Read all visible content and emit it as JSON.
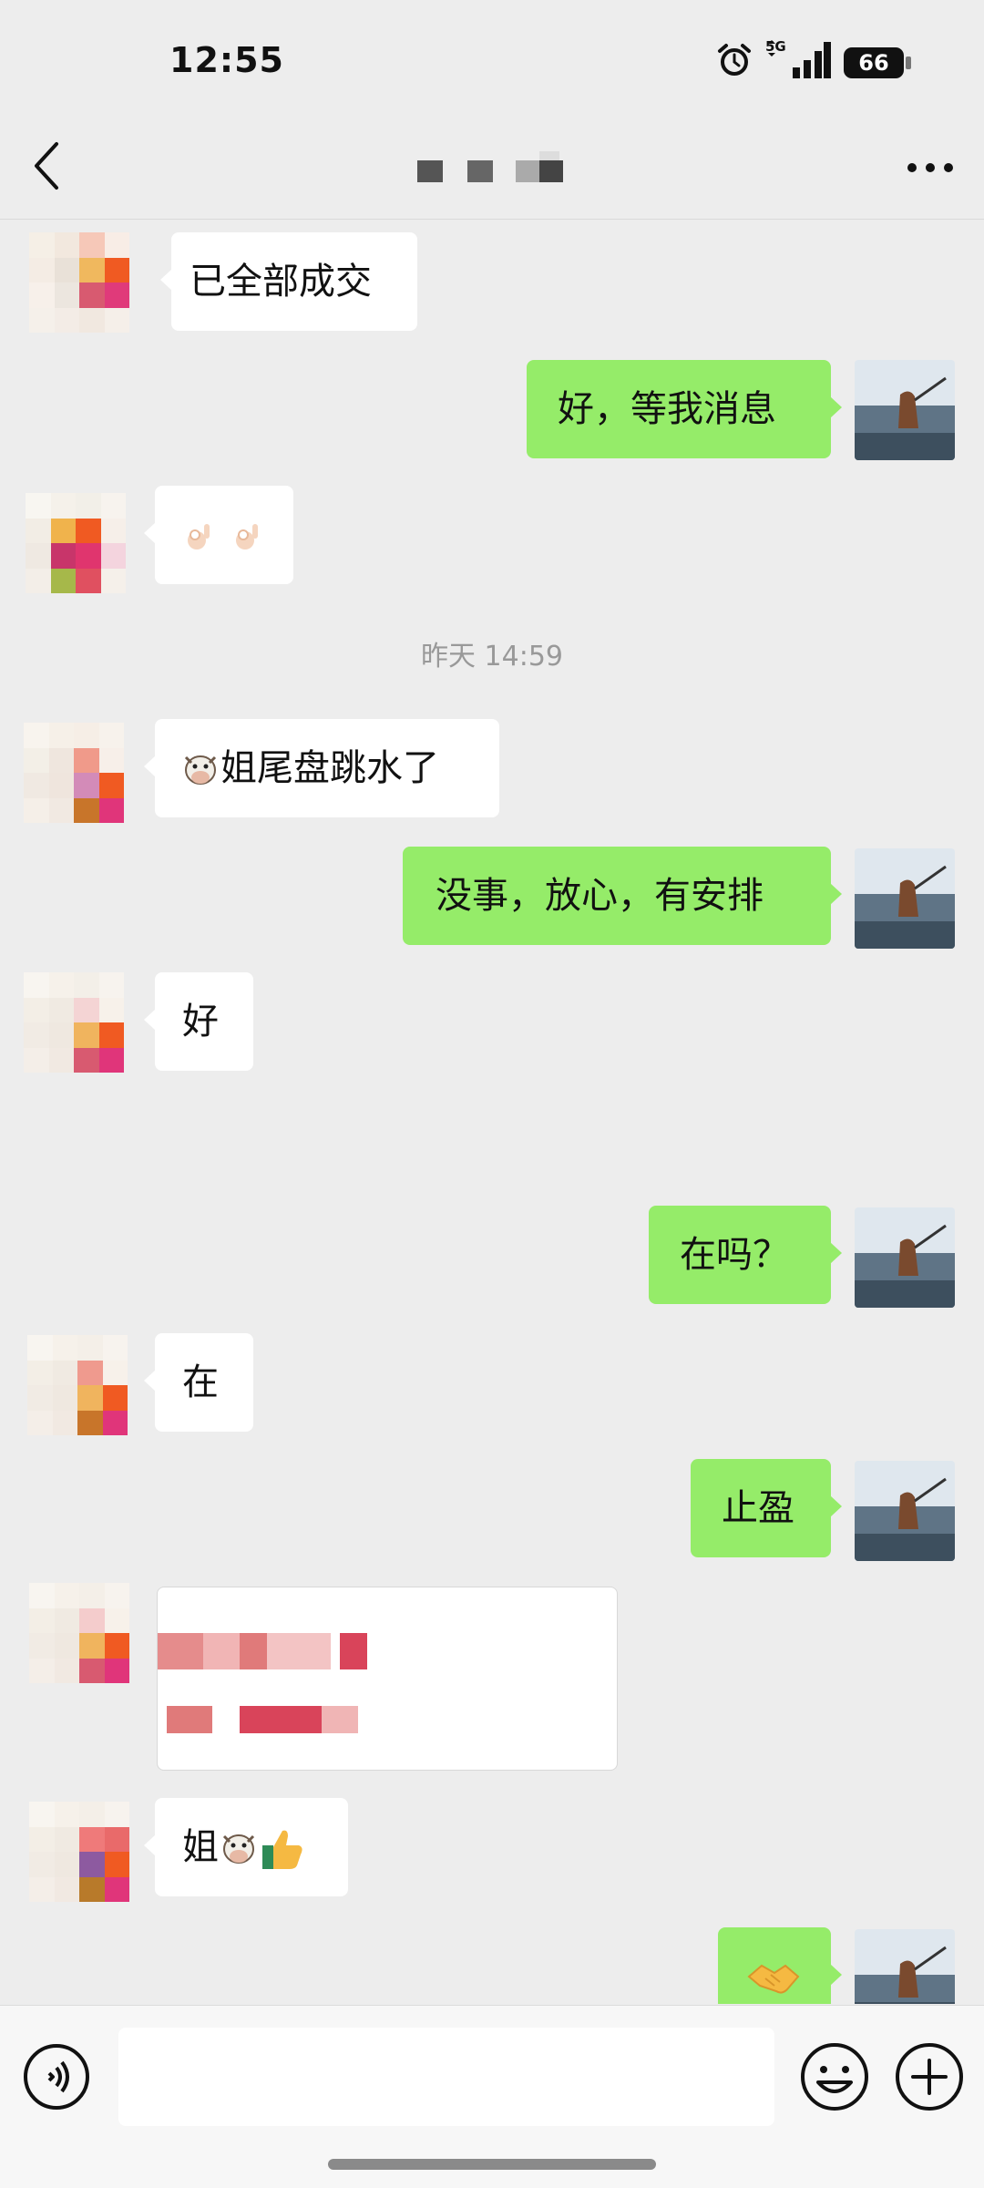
{
  "status_bar": {
    "time": "12:55",
    "network": "5G",
    "battery": "66"
  },
  "nav": {
    "title": "",
    "back_icon": "chevron-left-icon",
    "more_icon": "more-dots-icon"
  },
  "colors": {
    "background": "#ededed",
    "outgoing_bubble": "#95ec69",
    "incoming_bubble": "#ffffff",
    "timestamp_text": "#999999"
  },
  "chat": {
    "timestamp": "昨天 14:59",
    "messages": [
      {
        "direction": "in",
        "text": "已全部成交"
      },
      {
        "direction": "out",
        "text": "好，等我消息"
      },
      {
        "direction": "in",
        "text": "",
        "emoji": [
          "ok-hand-emoji",
          "ok-hand-emoji"
        ]
      },
      {
        "direction": "in",
        "text": "姐尾盘跳水了",
        "emoji": [
          "cow-face-emoji"
        ]
      },
      {
        "direction": "out",
        "text": "没事，放心，有安排"
      },
      {
        "direction": "in",
        "text": "好"
      },
      {
        "direction": "out",
        "text": "在吗？"
      },
      {
        "direction": "in",
        "text": "在"
      },
      {
        "direction": "out",
        "text": "止盈"
      },
      {
        "direction": "in",
        "text": "",
        "type": "redacted-image"
      },
      {
        "direction": "in",
        "text": "姐",
        "emoji": [
          "cow-face-emoji",
          "thumbs-up-emoji"
        ]
      },
      {
        "direction": "out",
        "text": "",
        "emoji": [
          "handshake-emoji"
        ]
      }
    ]
  },
  "input_bar": {
    "placeholder": "",
    "voice_icon": "voice-icon",
    "emoji_icon": "smiley-icon",
    "plus_icon": "plus-icon"
  }
}
